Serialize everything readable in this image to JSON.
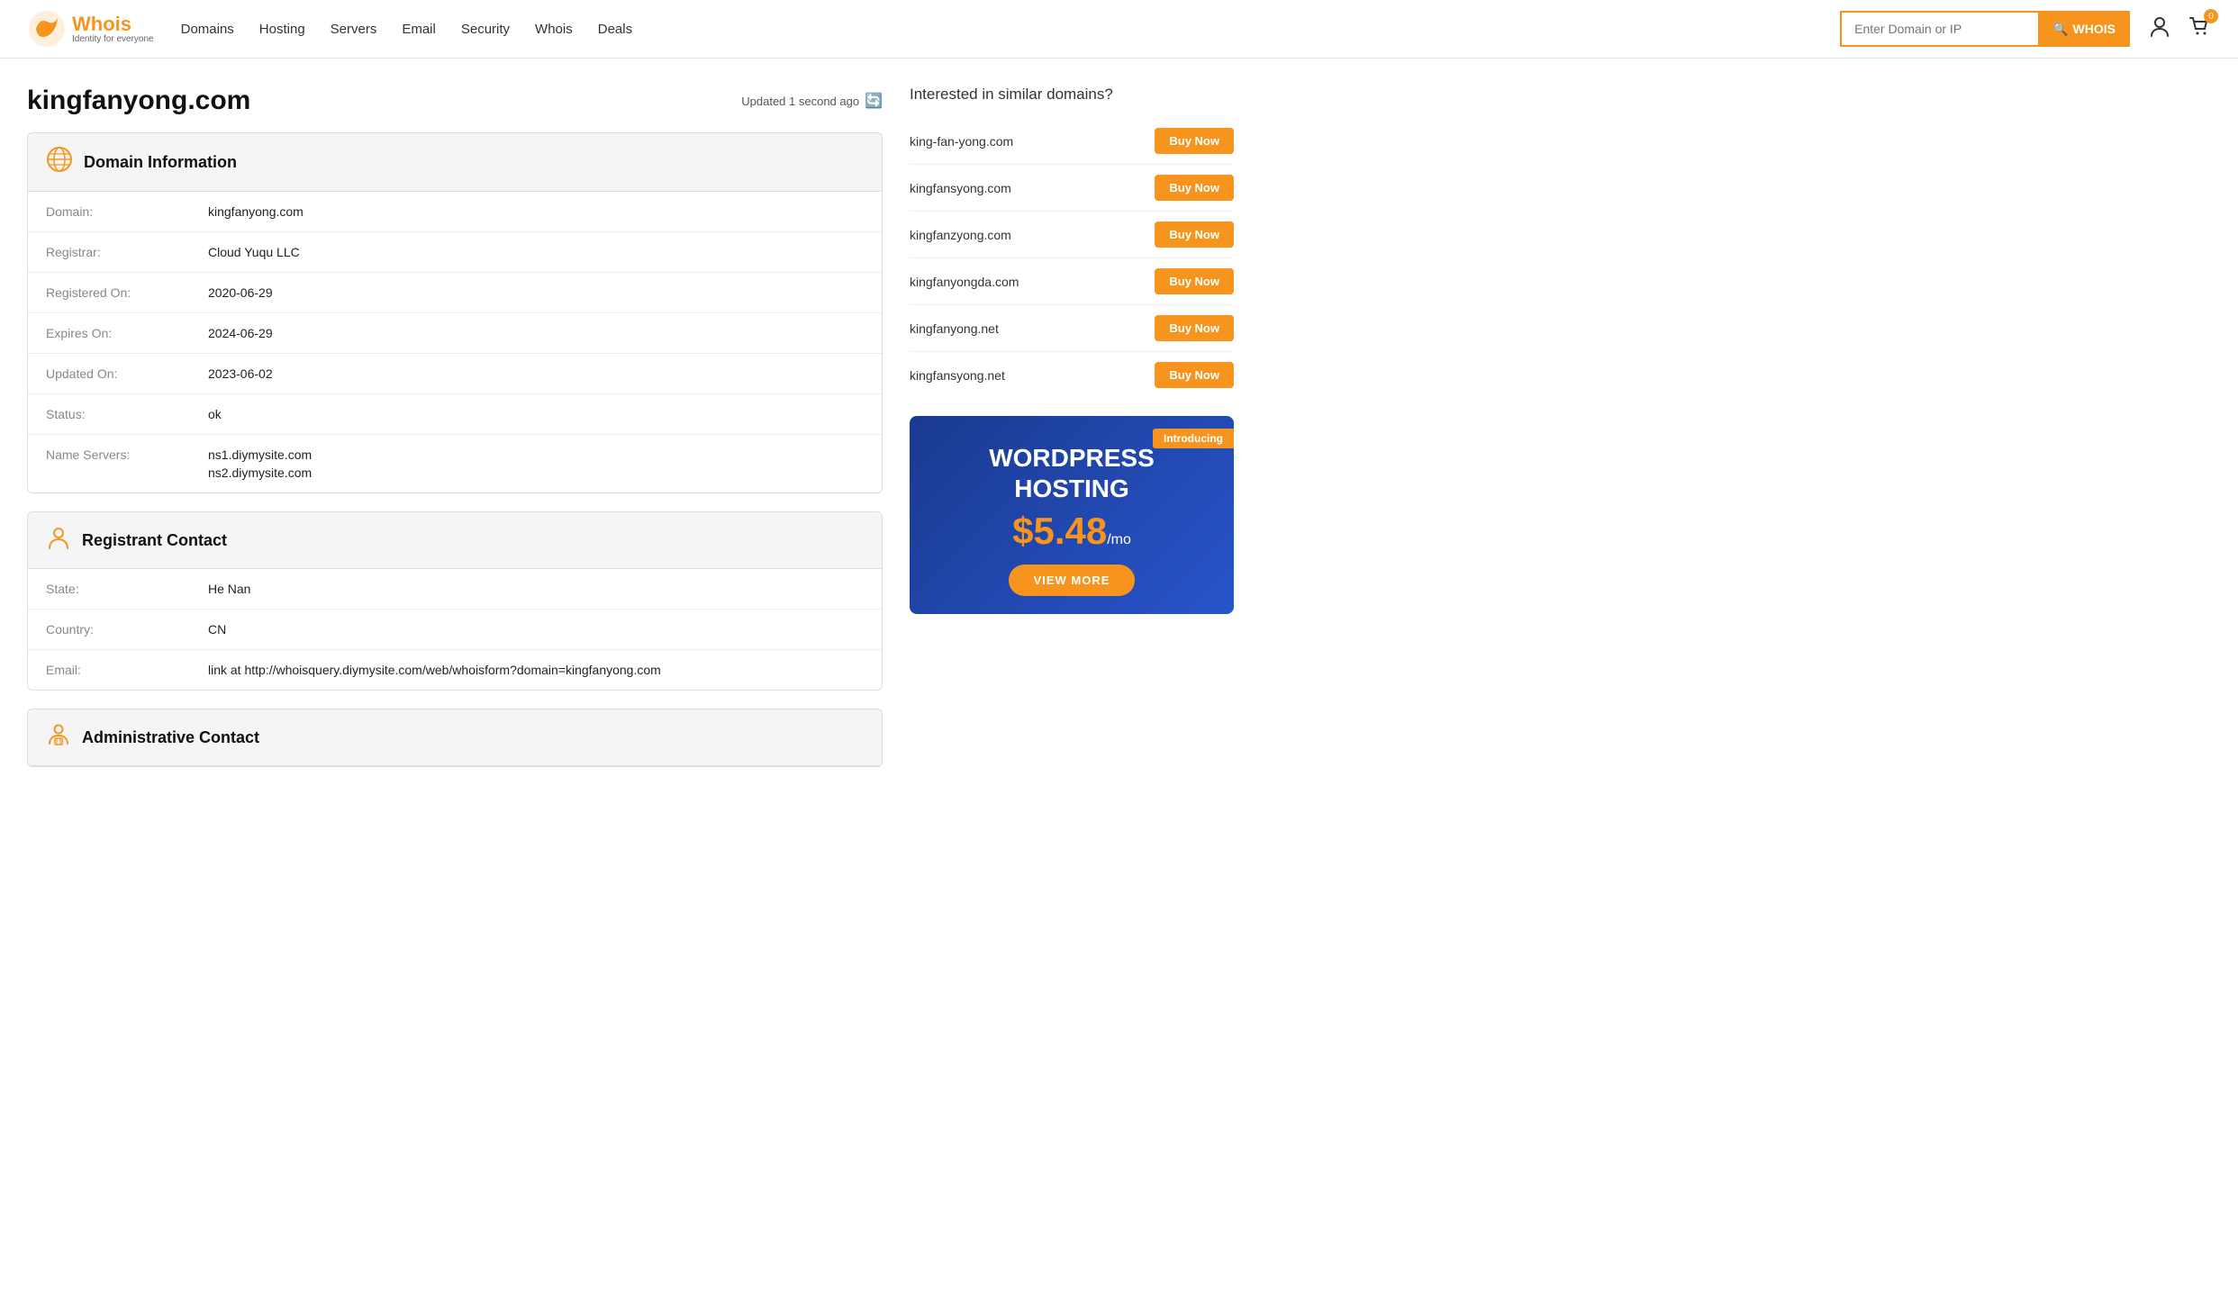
{
  "header": {
    "logo": {
      "text": "Whois",
      "tagline": "Identity for everyone"
    },
    "nav": [
      {
        "label": "Domains",
        "href": "#"
      },
      {
        "label": "Hosting",
        "href": "#"
      },
      {
        "label": "Servers",
        "href": "#"
      },
      {
        "label": "Email",
        "href": "#"
      },
      {
        "label": "Security",
        "href": "#"
      },
      {
        "label": "Whois",
        "href": "#"
      },
      {
        "label": "Deals",
        "href": "#"
      }
    ],
    "search_placeholder": "Enter Domain or IP",
    "search_button": "WHOIS",
    "cart_count": "0"
  },
  "main": {
    "domain": "kingfanyong.com",
    "updated_text": "Updated 1 second ago",
    "sections": [
      {
        "id": "domain-info",
        "title": "Domain Information",
        "rows": [
          {
            "label": "Domain:",
            "value": "kingfanyong.com"
          },
          {
            "label": "Registrar:",
            "value": "Cloud Yuqu LLC"
          },
          {
            "label": "Registered On:",
            "value": "2020-06-29"
          },
          {
            "label": "Expires On:",
            "value": "2024-06-29"
          },
          {
            "label": "Updated On:",
            "value": "2023-06-02"
          },
          {
            "label": "Status:",
            "value": "ok"
          },
          {
            "label": "Name Servers:",
            "value": "ns1.diymysite.com\nns2.diymysite.com",
            "multi": true
          }
        ]
      },
      {
        "id": "registrant-contact",
        "title": "Registrant Contact",
        "rows": [
          {
            "label": "State:",
            "value": "He Nan"
          },
          {
            "label": "Country:",
            "value": "CN"
          },
          {
            "label": "Email:",
            "value": "link at http://whoisquery.diymysite.com/web/whoisform?domain=kingfanyong.com"
          }
        ]
      },
      {
        "id": "administrative-contact",
        "title": "Administrative Contact",
        "rows": []
      }
    ]
  },
  "sidebar": {
    "similar_title": "Interested in similar domains?",
    "domains": [
      {
        "name": "king-fan-yong.com",
        "btn": "Buy Now"
      },
      {
        "name": "kingfansyong.com",
        "btn": "Buy Now"
      },
      {
        "name": "kingfanzyong.com",
        "btn": "Buy Now"
      },
      {
        "name": "kingfanyongda.com",
        "btn": "Buy Now"
      },
      {
        "name": "kingfanyong.net",
        "btn": "Buy Now"
      },
      {
        "name": "kingfansyong.net",
        "btn": "Buy Now"
      }
    ],
    "ad": {
      "introducing": "Introducing",
      "title": "WORDPRESS\nHOSTING",
      "price": "$5.48",
      "per_mo": "/mo",
      "btn": "VIEW MORE"
    }
  }
}
